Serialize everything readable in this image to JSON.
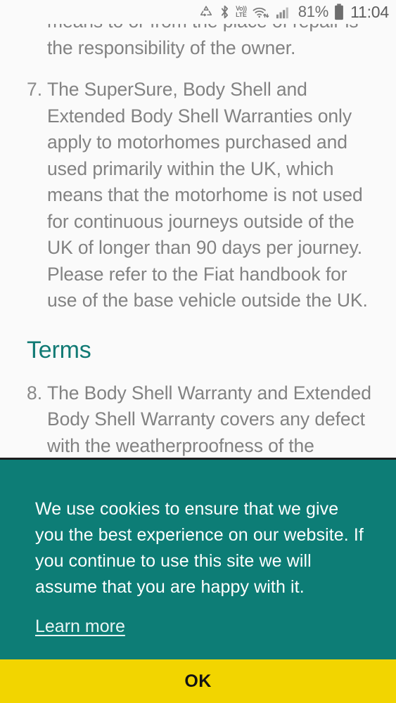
{
  "status_bar": {
    "icons": [
      {
        "name": "data-saver-icon",
        "glyph": "♻"
      },
      {
        "name": "bluetooth-icon",
        "glyph": "ᛦ"
      },
      {
        "name": "volte-icon",
        "line1": "Vo))",
        "line2": "LTE"
      },
      {
        "name": "wifi-icon",
        "glyph": "◠"
      },
      {
        "name": "signal-bars-icon",
        "glyph": "▂"
      }
    ],
    "battery_percent": "81%",
    "clock": "11:04"
  },
  "page": {
    "clipped_top_text": "means to or from the place of repair is the responsibility of the owner.",
    "items": [
      {
        "marker": "7.",
        "text": "The SuperSure, Body Shell and Extended Body Shell Warranties only apply to motorhomes purchased and used primarily within the UK, which means that the motorhome is not used for continuous journeys outside of the UK of longer than 90 days per journey. Please refer to the Fiat handbook for use of the base vehicle outside the UK."
      },
      {
        "marker": "8.",
        "text": "The Body Shell Warranty and Extended Body Shell Warranty covers any defect with the weatherproofness of the"
      }
    ],
    "section_heading": "Terms"
  },
  "cookie_banner": {
    "message": "We use cookies to ensure that we give you the best experience on our website. If you continue to use this site we will assume that you are happy with it.",
    "learn_more_label": "Learn more",
    "background_color": "#0d7d76"
  },
  "ok_button": {
    "label": "OK",
    "background_color": "#f2d500",
    "text_color": "#131313"
  }
}
